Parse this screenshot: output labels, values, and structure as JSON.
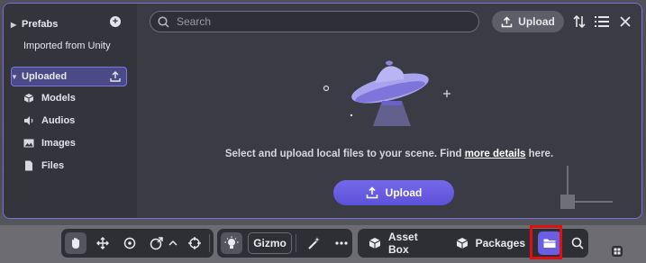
{
  "sidebar": {
    "prefabs_label": "Prefabs",
    "imported_label": "Imported from Unity",
    "uploaded_label": "Uploaded",
    "items": [
      {
        "label": "Models"
      },
      {
        "label": "Audios"
      },
      {
        "label": "Images"
      },
      {
        "label": "Files"
      }
    ]
  },
  "search": {
    "placeholder": "Search",
    "value": ""
  },
  "header": {
    "upload_label": "Upload"
  },
  "empty_state": {
    "text_before": "Select and upload local files to your scene. Find ",
    "link": "more details",
    "text_after": " here.",
    "upload_button": "Upload"
  },
  "toolbar": {
    "gizmo_label": "Gizmo",
    "asset_box_label": "Asset Box",
    "packages_label": "Packages"
  },
  "colors": {
    "accent": "#6a5fe3",
    "highlight": "#e01010",
    "panel": "#3b3b45"
  }
}
